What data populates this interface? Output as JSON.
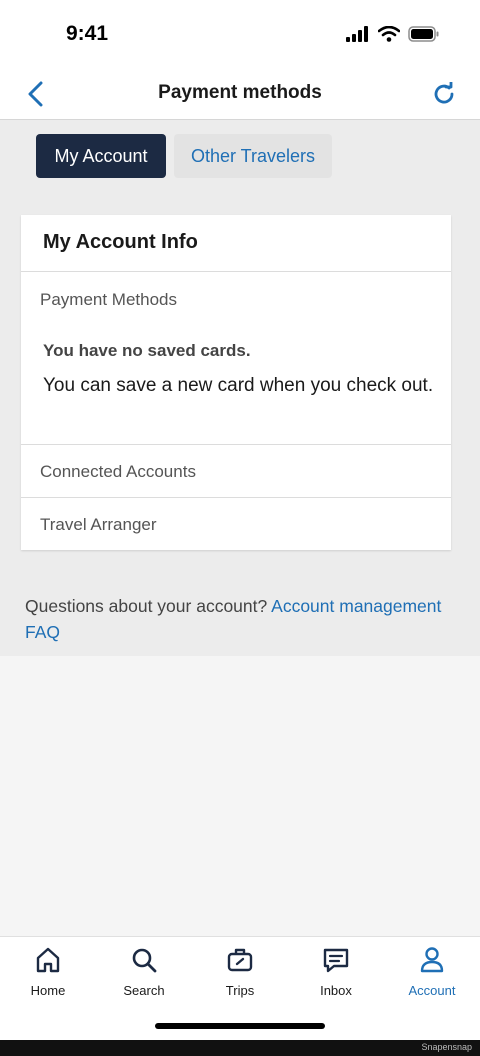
{
  "status_bar": {
    "time": "9:41"
  },
  "nav": {
    "title": "Payment methods"
  },
  "tabs": {
    "my_account": "My Account",
    "other_travelers": "Other Travelers"
  },
  "card": {
    "title": "My Account Info",
    "payment_methods_label": "Payment Methods",
    "no_cards": "You have no saved cards.",
    "save_hint": "You can save a new card when you check out.",
    "connected_accounts_label": "Connected Accounts",
    "travel_arranger_label": "Travel Arranger"
  },
  "faq": {
    "question": "Questions about your account? ",
    "link": "Account management FAQ"
  },
  "tabbar": {
    "items": [
      {
        "label": "Home",
        "icon": "home-icon"
      },
      {
        "label": "Search",
        "icon": "search-icon"
      },
      {
        "label": "Trips",
        "icon": "briefcase-icon"
      },
      {
        "label": "Inbox",
        "icon": "message-icon"
      },
      {
        "label": "Account",
        "icon": "person-icon"
      }
    ],
    "active": "Account"
  },
  "watermark": "Snapensnap",
  "colors": {
    "accent": "#1f6fb5",
    "dark_tab": "#1c2a43",
    "background": "#ececec"
  }
}
